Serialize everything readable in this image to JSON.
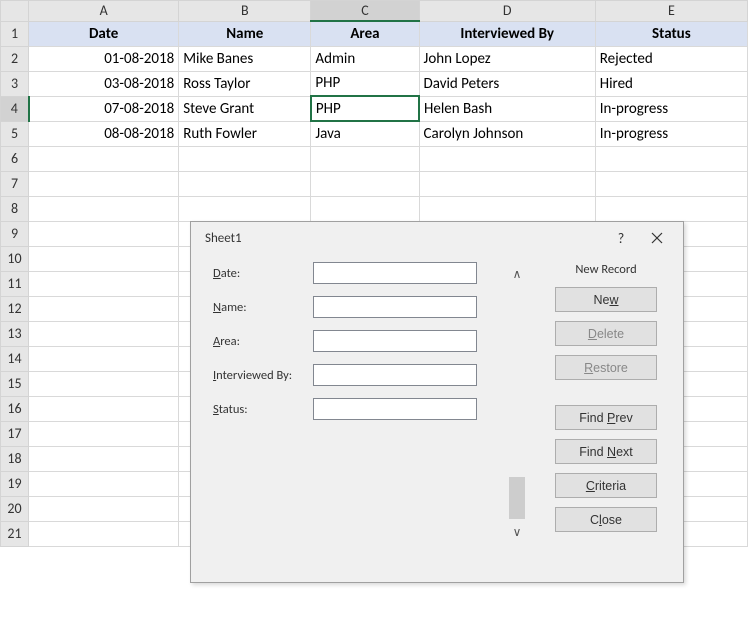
{
  "columns": [
    "A",
    "B",
    "C",
    "D",
    "E"
  ],
  "row_count": 21,
  "selected": {
    "row": 4,
    "col": "C"
  },
  "headers": {
    "A": "Date",
    "B": "Name",
    "C": "Area",
    "D": "Interviewed By",
    "E": "Status"
  },
  "rows": [
    {
      "A": "01-08-2018",
      "B": "Mike Banes",
      "C": "Admin",
      "D": "John Lopez",
      "E": "Rejected"
    },
    {
      "A": "03-08-2018",
      "B": "Ross Taylor",
      "C": "PHP",
      "D": "David Peters",
      "E": "Hired"
    },
    {
      "A": "07-08-2018",
      "B": "Steve Grant",
      "C": "PHP",
      "D": "Helen Bash",
      "E": "In-progress"
    },
    {
      "A": "08-08-2018",
      "B": "Ruth Fowler",
      "C": "Java",
      "D": "Carolyn Johnson",
      "E": "In-progress"
    }
  ],
  "dialog": {
    "title": "Sheet1",
    "help": "?",
    "record_label": "New Record",
    "fields": {
      "date": {
        "label": "Date:",
        "accel": "D",
        "value": ""
      },
      "name": {
        "label": "Name:",
        "accel": "N",
        "value": ""
      },
      "area": {
        "label": "Area:",
        "accel": "A",
        "value": ""
      },
      "interviewed": {
        "label": "Interviewed By:",
        "accel": "I",
        "value": ""
      },
      "status": {
        "label": "Status:",
        "accel": "S",
        "value": ""
      }
    },
    "buttons": {
      "new": "New",
      "new_accel": "w",
      "delete": "Delete",
      "delete_accel": "D",
      "restore": "Restore",
      "restore_accel": "R",
      "findprev": "Find Prev",
      "findprev_accel": "P",
      "findnext": "Find Next",
      "findnext_accel": "N",
      "criteria": "Criteria",
      "criteria_accel": "C",
      "close": "Close",
      "close_accel": "L"
    }
  }
}
